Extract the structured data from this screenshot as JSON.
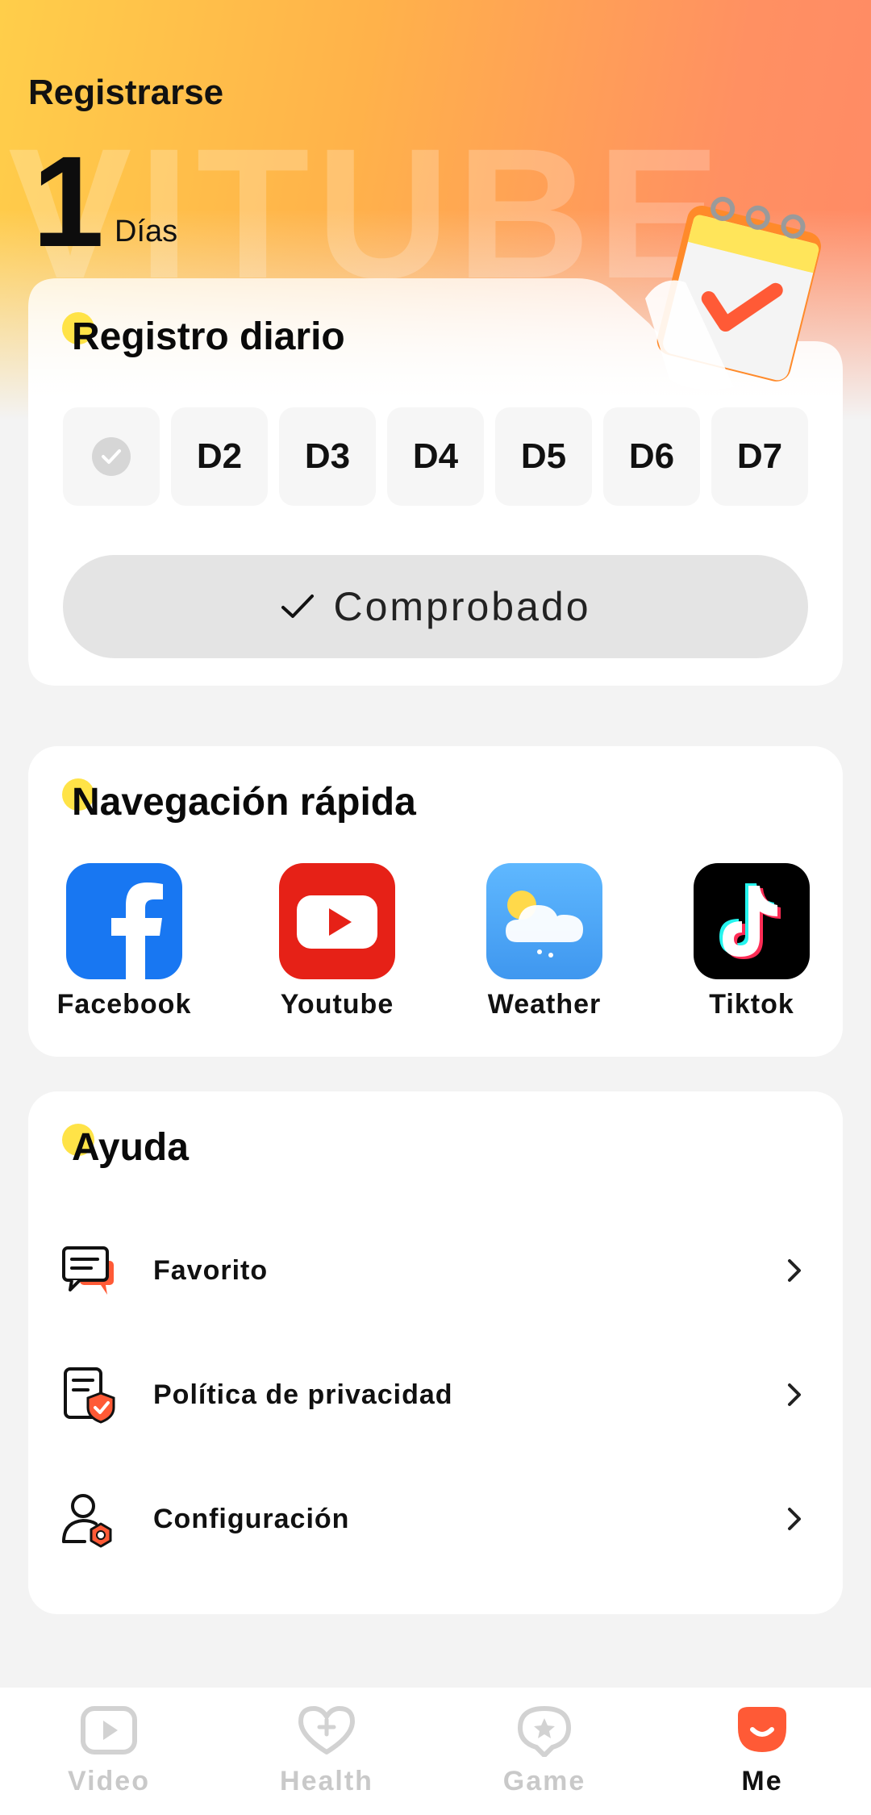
{
  "header": {
    "watermark": "VITUBE",
    "title": "Registrarse",
    "days_count": "1",
    "days_unit": "Días"
  },
  "daily_checkin": {
    "title": "Registro diario",
    "days": [
      "",
      "D2",
      "D3",
      "D4",
      "D5",
      "D6",
      "D7"
    ],
    "checked_day_index": 0,
    "button_label": "Comprobado",
    "button_icon": "checkmark-icon"
  },
  "quick_nav": {
    "title": "Navegación rápida",
    "apps": [
      {
        "label": "Facebook",
        "icon": "facebook-icon"
      },
      {
        "label": "Youtube",
        "icon": "youtube-icon"
      },
      {
        "label": "Weather",
        "icon": "weather-icon"
      },
      {
        "label": "Tiktok",
        "icon": "tiktok-icon"
      }
    ]
  },
  "help": {
    "title": "Ayuda",
    "items": [
      {
        "label": "Favorito",
        "icon": "chat-bubbles-icon"
      },
      {
        "label": "Política de privacidad",
        "icon": "privacy-shield-icon"
      },
      {
        "label": "Configuración",
        "icon": "user-settings-icon"
      }
    ]
  },
  "bottom_nav": {
    "items": [
      {
        "label": "Video",
        "icon": "video-play-icon",
        "active": false
      },
      {
        "label": "Health",
        "icon": "heart-plus-icon",
        "active": false
      },
      {
        "label": "Game",
        "icon": "star-badge-icon",
        "active": false
      },
      {
        "label": "Me",
        "icon": "profile-icon",
        "active": true
      }
    ]
  },
  "colors": {
    "accent": "#ff5a36",
    "highlight_dot": "#ffe347",
    "inactive_nav": "#c9c9c9",
    "facebook": "#1877f2",
    "youtube": "#e62117",
    "weather": "#4aa8f5",
    "tiktok": "#000000"
  }
}
